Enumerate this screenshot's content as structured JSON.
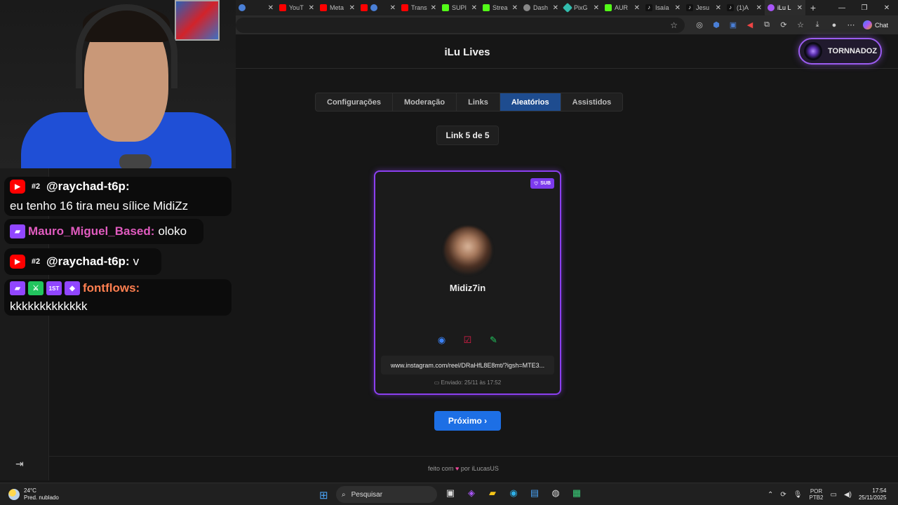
{
  "browser": {
    "tabs": [
      {
        "label": "",
        "icon": "globe-icon",
        "color": "#4a7fd6"
      },
      {
        "label": "YouT",
        "icon": "youtube-icon",
        "color": "#ff0000"
      },
      {
        "label": "Meta",
        "icon": "youtube-icon",
        "color": "#ff0000"
      },
      {
        "label": "",
        "icon": "youtube-icon",
        "color": "#ff0000"
      },
      {
        "label": "Trans",
        "icon": "youtube-icon",
        "color": "#ff0000"
      },
      {
        "label": "SUPI",
        "icon": "kick-icon",
        "color": "#53fc18"
      },
      {
        "label": "Strea",
        "icon": "kick-icon",
        "color": "#53fc18"
      },
      {
        "label": "Dash",
        "icon": "globe-icon",
        "color": "#888888"
      },
      {
        "label": "PixG",
        "icon": "pix-icon",
        "color": "#32bcad"
      },
      {
        "label": "AUR",
        "icon": "kick-icon",
        "color": "#53fc18"
      },
      {
        "label": "Isaía",
        "icon": "tiktok-icon",
        "color": "#ffffff"
      },
      {
        "label": "Jesu",
        "icon": "tiktok-icon",
        "color": "#ffffff"
      },
      {
        "label": "(1)A",
        "icon": "tiktok-icon",
        "color": "#ffffff"
      },
      {
        "label": "iLu L",
        "icon": "ilu-icon",
        "color": "#a855f7",
        "active": true
      }
    ],
    "chat_label": "Chat"
  },
  "app": {
    "title": "iLu Lives",
    "user": "TORNNADOZ",
    "tabs": [
      "Configurações",
      "Moderação",
      "Links",
      "Aleatórios",
      "Assistidos"
    ],
    "active_tab": "Aleatórios",
    "counter": "Link 5 de 5",
    "card": {
      "badge": "SUB",
      "name": "Midiz7in",
      "url": "www.instagram.com/reel/DRaHfL8E8mt/?igsh=MTE3...",
      "sent": "Enviado: 25/11 às 17:52"
    },
    "next_label": "Próximo ›",
    "footer_before": "feito com",
    "footer_after": "por iLucasUS"
  },
  "chat": [
    {
      "platform": "youtube",
      "badge": "#2",
      "user": "@raychad-t6p:",
      "text": "eu tenho 16 tira meu sílice MidiZz",
      "user_color": "#ffffff"
    },
    {
      "platform": "twitch",
      "badge": "",
      "user": "Mauro_Miguel_Based:",
      "text": "oloko",
      "user_color": "#e05bbf"
    },
    {
      "platform": "youtube",
      "badge": "#2",
      "user": "@raychad-t6p:",
      "text": "v",
      "user_color": "#ffffff"
    },
    {
      "platform": "twitch",
      "badge": "1ST",
      "user": "fontflows:",
      "text": "kkkkkkkkkkkkk",
      "user_color": "#ff7f50"
    }
  ],
  "taskbar": {
    "temp": "24°C",
    "weather": "Pred. nublado",
    "search": "Pesquisar",
    "lang1": "POR",
    "lang2": "PTB2",
    "time": "17:54",
    "date": "25/11/2025"
  }
}
